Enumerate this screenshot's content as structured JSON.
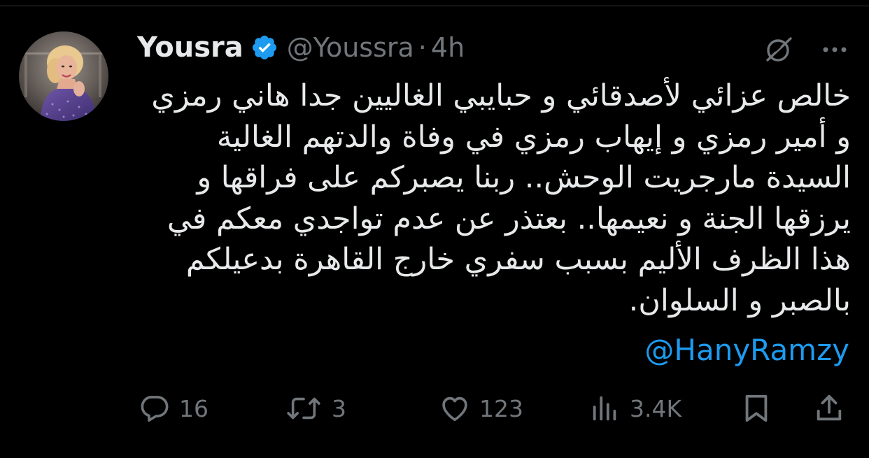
{
  "colors": {
    "background": "#000000",
    "primary_text": "#e7e9ea",
    "secondary_text": "#71767b",
    "link": "#1d9bf0",
    "verified": "#1d9bf0"
  },
  "tweet": {
    "author_name": "Yousra",
    "handle": "@Youssra",
    "separator": "·",
    "time": "4h",
    "verified": true,
    "text_lines": [
      "خالص عزائي لأصدقائي و حبايبي الغاليين جدا هاني رمزي",
      "و أمير رمزي و إيهاب رمزي في وفاة والدتهم الغالية",
      "السيدة مارجريت الوحش.. ربنا يصبركم على فراقها و",
      "يرزقها الجنة و نعيمها.. بعتذر عن عدم تواجدي معكم في",
      "هذا الظرف الأليم بسبب سفري خارج القاهرة بدعيلكم",
      "بالصبر و السلوان."
    ],
    "mention": "@HanyRamzy"
  },
  "actions": {
    "replies": "16",
    "reposts": "3",
    "likes": "123",
    "views": "3.4K"
  },
  "icons": {
    "avatar": "avatar",
    "verified": "verified-badge-icon",
    "grok": "grok-icon",
    "more": "more-icon",
    "reply": "reply-icon",
    "repost": "repost-icon",
    "like": "like-icon",
    "views": "views-icon",
    "bookmark": "bookmark-icon",
    "share": "share-icon"
  }
}
